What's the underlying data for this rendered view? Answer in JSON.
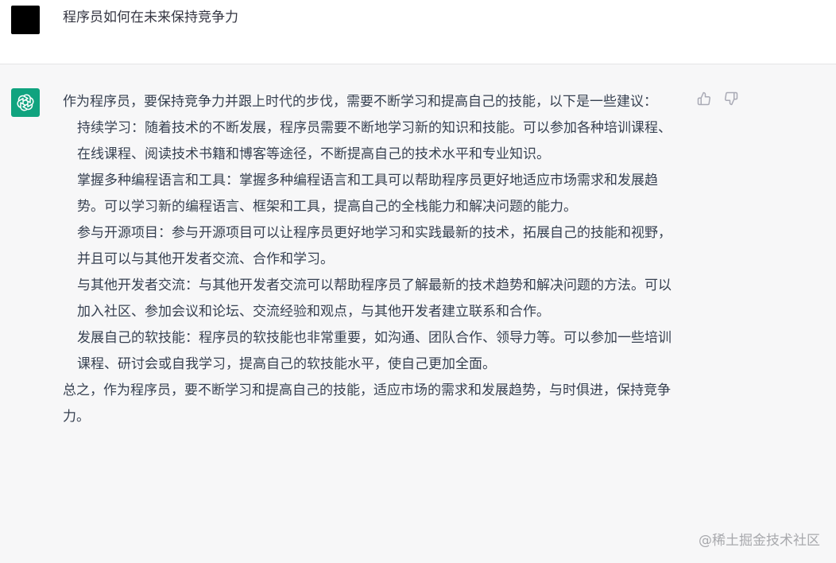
{
  "user_message": {
    "text": "程序员如何在未来保持竞争力"
  },
  "assistant_message": {
    "intro": "作为程序员，要保持竞争力并跟上时代的步伐，需要不断学习和提高自己的技能，以下是一些建议：",
    "items": [
      "持续学习：随着技术的不断发展，程序员需要不断地学习新的知识和技能。可以参加各种培训课程、在线课程、阅读技术书籍和博客等途径，不断提高自己的技术水平和专业知识。",
      "掌握多种编程语言和工具：掌握多种编程语言和工具可以帮助程序员更好地适应市场需求和发展趋势。可以学习新的编程语言、框架和工具，提高自己的全栈能力和解决问题的能力。",
      "参与开源项目：参与开源项目可以让程序员更好地学习和实践最新的技术，拓展自己的技能和视野，并且可以与其他开发者交流、合作和学习。",
      "与其他开发者交流：与其他开发者交流可以帮助程序员了解最新的技术趋势和解决问题的方法。可以加入社区、参加会议和论坛、交流经验和观点，与其他开发者建立联系和合作。",
      "发展自己的软技能：程序员的软技能也非常重要，如沟通、团队合作、领导力等。可以参加一些培训课程、研讨会或自我学习，提高自己的软技能水平，使自己更加全面。"
    ],
    "conclusion": "总之，作为程序员，要不断学习和提高自己的技能，适应市场的需求和发展趋势，与时俱进，保持竞争力。"
  },
  "icons": {
    "assistant_avatar": "openai-logo-icon",
    "thumbs_up": "thumbs-up-icon",
    "thumbs_down": "thumbs-down-icon"
  },
  "colors": {
    "assistant_avatar_bg": "#10a37f",
    "assistant_row_bg": "#f7f7f8",
    "user_avatar_bg": "#000000"
  },
  "watermark": "@稀土掘金技术社区"
}
